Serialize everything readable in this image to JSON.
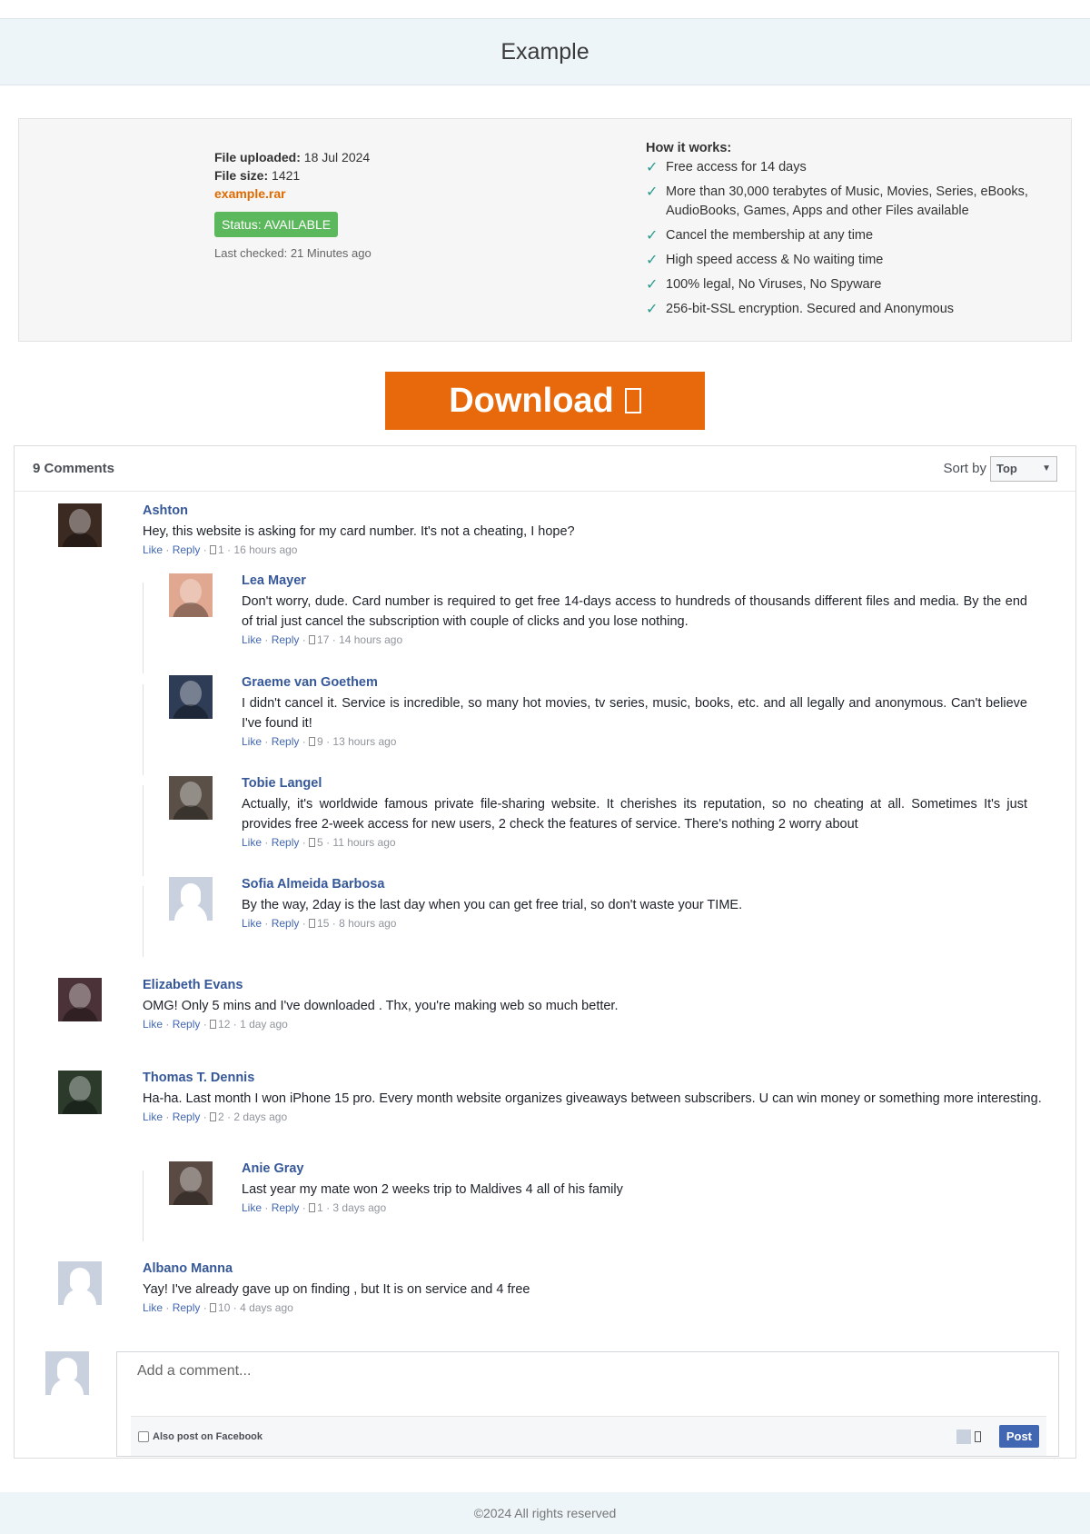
{
  "header": {
    "title": "Example"
  },
  "file": {
    "uploaded_label": "File uploaded:",
    "uploaded_value": " 18 Jul 2024",
    "size_label": "File size:",
    "size_value": " 1421",
    "filename": "example.rar",
    "status": "Status: AVAILABLE",
    "last_checked": "Last checked: 21 Minutes ago"
  },
  "how_it_works": {
    "title": "How it works:",
    "items": [
      "Free access for 14 days",
      "More than 30,000 terabytes of Music, Movies, Series, eBooks, AudioBooks, Games, Apps and other Files available",
      "Cancel the membership at any time",
      "High speed access & No waiting time",
      "100% legal, No Viruses, No Spyware",
      "256-bit-SSL encryption. Secured and Anonymous"
    ]
  },
  "download": {
    "label": "Download"
  },
  "comments_header": {
    "count": "9 Comments",
    "sort_label": "Sort by",
    "sort_value": "Top"
  },
  "meta_labels": {
    "like": "Like",
    "reply": "Reply",
    "sep": " · "
  },
  "comments": [
    {
      "name": "Ashton",
      "text": "Hey, this website is asking for my card number. It's not a cheating, I hope?",
      "likes": "1",
      "time": "16 hours ago",
      "avatar_color": "#3b2a22"
    },
    {
      "name": "Lea Mayer",
      "text": "Don't worry, dude. Card number is required to get free 14-days access to hundreds of thousands different files and media. By the end of trial just cancel the subscription with couple of clicks and you lose nothing.",
      "likes": "17",
      "time": "14 hours ago",
      "avatar_color": "#e0a890"
    },
    {
      "name": "Graeme van Goethem",
      "text": "I didn't cancel it. Service is incredible, so many hot movies, tv series, music, books, etc. and all legally and anonymous. Can't believe I've found it!",
      "likes": "9",
      "time": "13 hours ago",
      "avatar_color": "#2f3c55"
    },
    {
      "name": "Tobie Langel",
      "text": "Actually, it's worldwide famous private file-sharing website. It cherishes its reputation, so no cheating at all. Sometimes It's just provides free 2-week access for new users, 2 check the features of service. There's nothing 2 worry about",
      "likes": "5",
      "time": "11 hours ago",
      "avatar_color": "#5a5048"
    },
    {
      "name": "Sofia Almeida Barbosa",
      "text": "By the way, 2day is the last day when you can get free trial, so don't waste your TIME.",
      "likes": "15",
      "time": "8 hours ago",
      "avatar_color": ""
    },
    {
      "name": "Elizabeth Evans",
      "text": "OMG! Only 5 mins and I've downloaded . Thx, you're making web so much better.",
      "likes": "12",
      "time": "1 day ago",
      "avatar_color": "#4a3238"
    },
    {
      "name": "Thomas T. Dennis",
      "text": "Ha-ha. Last month I won iPhone 15 pro. Every month website organizes giveaways between subscribers. U can win money or something more interesting.",
      "likes": "2",
      "time": "2 days ago",
      "avatar_color": "#2c3a2c"
    },
    {
      "name": "Anie Gray",
      "text": "Last year my mate won 2 weeks trip to Maldives 4 all of his family",
      "likes": "1",
      "time": "3 days ago",
      "avatar_color": "#5a4a44"
    },
    {
      "name": "Albano Manna",
      "text": "Yay! I've already gave up on finding , but It is on service and 4 free",
      "likes": "10",
      "time": "4 days ago",
      "avatar_color": ""
    }
  ],
  "add_comment": {
    "placeholder": "Add a comment...",
    "facebook_label": "Also post on Facebook",
    "post_label": "Post"
  },
  "footer": {
    "text": "©2024 All rights reserved"
  }
}
